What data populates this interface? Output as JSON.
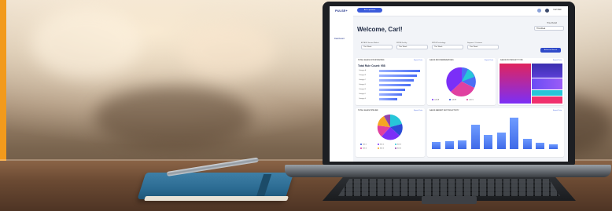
{
  "app": {
    "brand": "PULSE+",
    "ask_button": "Ask a question",
    "user_name": "Carl Main"
  },
  "sidebar": {
    "items": [
      {
        "label": "Dashboard"
      }
    ]
  },
  "header": {
    "welcome": "Welcome, Carl!",
    "period_label": "Time Period",
    "period_value": "This Week"
  },
  "filters": [
    {
      "label": "ATTACH Service Market",
      "value": "This Week"
    },
    {
      "label": "WPDB Facility",
      "value": "This Week"
    },
    {
      "label": "WPDB Technology",
      "value": "This Week"
    },
    {
      "label": "Segment / Customer",
      "value": "This Week"
    }
  ],
  "advanced_button": "Advanced Search",
  "cards": {
    "opportunities": {
      "title": "TOTAL SALES OPPORTUNITIES",
      "link": "Export Data",
      "stat": "Total Rule Count: 958",
      "bars": [
        {
          "label": "Category A",
          "value": 100
        },
        {
          "label": "Category B",
          "value": 92
        },
        {
          "label": "Category C",
          "value": 84
        },
        {
          "label": "Category D",
          "value": 76
        },
        {
          "label": "Category E",
          "value": 64
        },
        {
          "label": "Category F",
          "value": 55
        },
        {
          "label": "Category G",
          "value": 44
        }
      ]
    },
    "recommendations": {
      "title": "SALES RECOMMENDATIONS",
      "link": "Export Data",
      "legend": [
        {
          "label": "Label A",
          "color": "#7b2ff7"
        },
        {
          "label": "Label B",
          "color": "#2b4bd6"
        },
        {
          "label": "Label C",
          "color": "#e040a0"
        }
      ]
    },
    "product_type": {
      "title": "SALES BY PRODUCT TYPE",
      "link": "Export Data"
    },
    "pipeline": {
      "title": "TOTAL SALES PIPELINE",
      "link": "Export Data",
      "legend": [
        {
          "label": "Item 1",
          "color": "#2b4bd6"
        },
        {
          "label": "Item 2",
          "color": "#7b2ff7"
        },
        {
          "label": "Item 3",
          "color": "#27c6d9"
        },
        {
          "label": "Item 4",
          "color": "#e040a0"
        },
        {
          "label": "Item 5",
          "color": "#f5a623"
        },
        {
          "label": "Item 6",
          "color": "#8e44ad"
        }
      ]
    },
    "market": {
      "title": "SALES MARKET SECTOR ACTIVITY",
      "link": "Export Data",
      "bars": [
        20,
        22,
        24,
        70,
        40,
        48,
        90,
        30,
        18,
        14
      ]
    }
  }
}
